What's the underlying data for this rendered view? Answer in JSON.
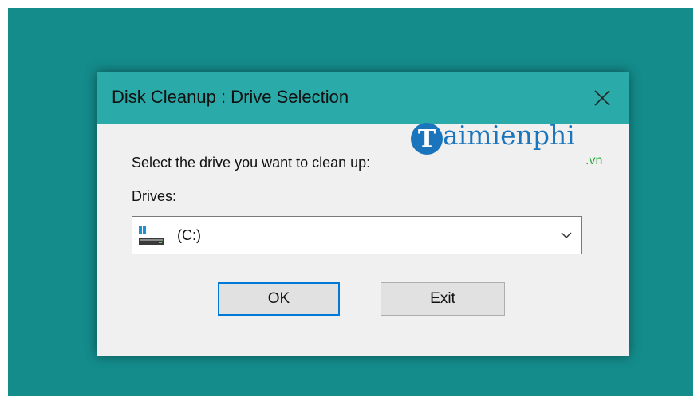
{
  "colors": {
    "desktop": "#148c8c",
    "titlebar": "#2aaaa8",
    "dialog_bg": "#f0f0f0",
    "ok_focus_border": "#0078d7",
    "watermark_blue": "#1b75bc",
    "watermark_green": "#2eaa3c"
  },
  "window": {
    "title": "Disk Cleanup : Drive Selection",
    "close_icon": "close-icon"
  },
  "dialog": {
    "prompt": "Select the drive you want to clean up:",
    "drives_label": "Drives:",
    "drive_select": {
      "selected_value": "(C:)",
      "icon": "windows-drive-icon"
    }
  },
  "buttons": {
    "ok_label": "OK",
    "exit_label": "Exit"
  },
  "watermark": {
    "logo_letter": "T",
    "brand": "aimienphi",
    "domain": ".vn"
  }
}
